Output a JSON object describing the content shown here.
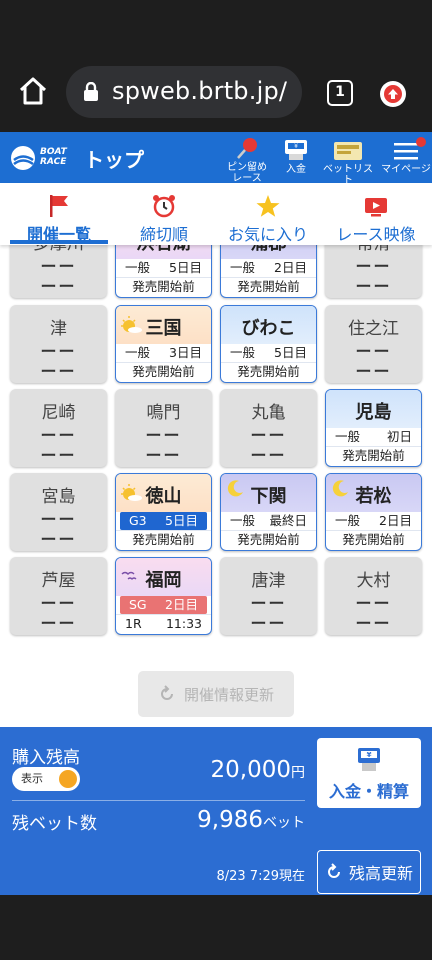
{
  "browser": {
    "url": "spweb.brtb.jp/",
    "tab_count": "1"
  },
  "header": {
    "logo_line1": "BOAT",
    "logo_line2": "RACE",
    "title": "トップ",
    "pin_label_1": "ピン留め",
    "pin_label_2": "レース",
    "deposit_label": "入金",
    "betlist_label": "ベットリスト",
    "mypage_label": "マイページ"
  },
  "tabs": [
    {
      "label": "開催一覧",
      "icon": "flag-icon"
    },
    {
      "label": "締切順",
      "icon": "alarm-clock-icon"
    },
    {
      "label": "お気に入り",
      "icon": "star-icon"
    },
    {
      "label": "レース映像",
      "icon": "video-icon"
    }
  ],
  "venues": {
    "row0": [
      {
        "name": "多摩川",
        "dash1": "ーー",
        "dash2": "ーー"
      },
      {
        "name": "浜名湖",
        "grade": "一般",
        "day": "5日目",
        "status": "発売開始前"
      },
      {
        "name": "蒲郡",
        "grade": "一般",
        "day": "2日目",
        "status": "発売開始前"
      },
      {
        "name": "常滑",
        "dash1": "ーー",
        "dash2": "ーー"
      }
    ],
    "row1": [
      {
        "name": "津",
        "dash1": "ーー",
        "dash2": "ーー"
      },
      {
        "name": "三国",
        "grade": "一般",
        "day": "3日目",
        "status": "発売開始前"
      },
      {
        "name": "びわこ",
        "grade": "一般",
        "day": "5日目",
        "status": "発売開始前"
      },
      {
        "name": "住之江",
        "dash1": "ーー",
        "dash2": "ーー"
      }
    ],
    "row2": [
      {
        "name": "尼崎",
        "dash1": "ーー",
        "dash2": "ーー"
      },
      {
        "name": "鳴門",
        "dash1": "ーー",
        "dash2": "ーー"
      },
      {
        "name": "丸亀",
        "dash1": "ーー",
        "dash2": "ーー"
      },
      {
        "name": "児島",
        "grade": "一般",
        "day": "初日",
        "status": "発売開始前"
      }
    ],
    "row3": [
      {
        "name": "宮島",
        "dash1": "ーー",
        "dash2": "ーー"
      },
      {
        "name": "徳山",
        "grade": "G3",
        "day": "5日目",
        "status": "発売開始前"
      },
      {
        "name": "下関",
        "grade": "一般",
        "day": "最終日",
        "status": "発売開始前"
      },
      {
        "name": "若松",
        "grade": "一般",
        "day": "2日目",
        "status": "発売開始前"
      }
    ],
    "row4": [
      {
        "name": "芦屋",
        "dash1": "ーー",
        "dash2": "ーー"
      },
      {
        "name": "福岡",
        "grade": "SG",
        "day": "2日目",
        "race": "1R",
        "time": "11:33"
      },
      {
        "name": "唐津",
        "dash1": "ーー",
        "dash2": "ーー"
      },
      {
        "name": "大村",
        "dash1": "ーー",
        "dash2": "ーー"
      }
    ]
  },
  "refresh_info_label": "開催情報更新",
  "balance": {
    "title": "購入残高",
    "toggle_label": "表示",
    "amount": "20,000",
    "amount_unit": "円",
    "bet_label": "残ベット数",
    "bet_count": "9,986",
    "bet_unit": "ベット",
    "deposit_button": "入金・精算",
    "as_of": "8/23 7:29現在",
    "refresh_button": "残高更新"
  },
  "colors": {
    "brand_blue": "#1d6ed2",
    "panel_blue": "#2c6dd2",
    "g3_badge": "#1f66d0",
    "sg_badge": "#e97373",
    "toggle_knob": "#f5a623"
  }
}
